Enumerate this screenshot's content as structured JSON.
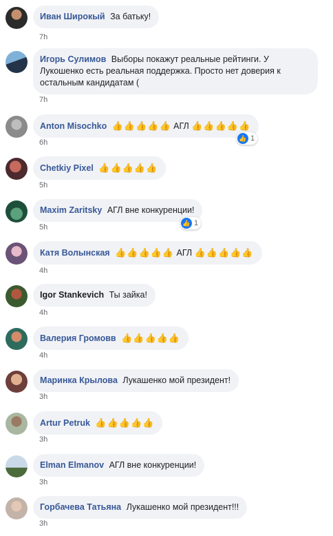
{
  "comments": [
    {
      "author": "Иван Широкый",
      "text": "За батьку!",
      "time": "7h"
    },
    {
      "author": "Игорь Сулимов",
      "text": "Выборы покажут реальные рейтинги. У Лукошенко есть реальная поддержка. Просто нет доверия к остальным кандидатам (",
      "time": "7h"
    },
    {
      "author": "Anton Misochko",
      "pre": "👍👍👍👍👍",
      "text": "АГЛ",
      "post": "👍👍👍👍👍",
      "time": "6h",
      "likes": "1"
    },
    {
      "author": "Chetkiy Pixel",
      "pre": "👍👍👍👍👍",
      "time": "5h"
    },
    {
      "author": "Maxim Zaritsky",
      "text": "АГЛ вне конкуренции!",
      "time": "5h",
      "likes": "1"
    },
    {
      "author": "Катя Волынская",
      "pre": "👍👍👍👍👍",
      "text": "АГЛ",
      "post": "👍👍👍👍👍",
      "time": "4h"
    },
    {
      "author": "Igor Stankevich",
      "text": "Ты зайка!",
      "time": "4h"
    },
    {
      "author": "Валерия Громовв",
      "pre": "👍👍👍👍👍",
      "time": "4h"
    },
    {
      "author": "Маринка Крылова",
      "text": "Лукашенко мой президент!",
      "time": "3h"
    },
    {
      "author": "Artur Petruk",
      "pre": "👍👍👍👍👍",
      "time": "3h"
    },
    {
      "author": "Elman Elmanov",
      "text": "АГЛ вне конкуренции!",
      "time": "3h"
    },
    {
      "author": "Горбачева Татьяна",
      "text": "Лукашенко мой президент!!!",
      "time": "3h"
    }
  ],
  "like_icon": "thumbs-up-icon",
  "colors": {
    "author": "#385898",
    "bubble": "#f0f2f5",
    "like": "#1877f2",
    "thumb": "#f5b400"
  }
}
